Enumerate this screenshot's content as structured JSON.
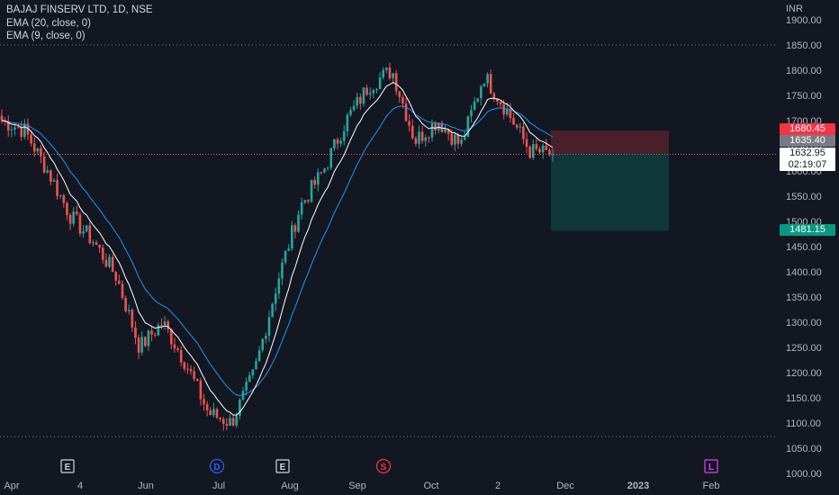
{
  "header": {
    "title": "BAJAJ FINSERV LTD, 1D, NSE",
    "indicators": [
      "EMA (20, close, 0)",
      "EMA (9, close, 0)"
    ],
    "currency": "INR"
  },
  "price_tags": {
    "stop_loss": "1680.45",
    "entry": "1635.40",
    "last": "1632.95",
    "countdown": "02:19:07",
    "target": "1481.15"
  },
  "events": [
    {
      "label": "E",
      "type": "earnings",
      "color": "#d1d4dc"
    },
    {
      "label": "D",
      "type": "dividend",
      "color": "#2962ff"
    },
    {
      "label": "E",
      "type": "earnings",
      "color": "#d1d4dc"
    },
    {
      "label": "S",
      "type": "split",
      "color": "#f23645"
    },
    {
      "label": "L",
      "type": "listing",
      "color": "#e040fb"
    }
  ],
  "colors": {
    "background": "#131722",
    "up": "#26a69a",
    "down": "#ef5350",
    "ema20": "#2196f3",
    "ema9": "#ffffff",
    "grid": "#1e222d",
    "axis_text": "#b2b5be",
    "stop_zone": "rgba(242,54,69,0.25)",
    "target_zone": "rgba(8,153,129,0.25)"
  },
  "chart_data": {
    "type": "candlestick",
    "title": "BAJAJ FINSERV LTD, 1D, NSE",
    "ylabel": "INR",
    "ylim": [
      1000,
      1900
    ],
    "y_ticks": [
      "1900.00",
      "1850.00",
      "1800.00",
      "1750.00",
      "1700.00",
      "1650.00",
      "1600.00",
      "1550.00",
      "1500.00",
      "1450.00",
      "1400.00",
      "1350.00",
      "1300.00",
      "1250.00",
      "1200.00",
      "1150.00",
      "1100.00",
      "1050.00",
      "1000.00"
    ],
    "x_ticks": [
      "Apr",
      "4",
      "Jun",
      "Jul",
      "Aug",
      "Sep",
      "Oct",
      "2",
      "Dec",
      "2023",
      "Feb"
    ],
    "grid": false,
    "dotted_levels": [
      1850,
      1073
    ],
    "key_points": [
      {
        "date": "Apr",
        "close": 1700
      },
      {
        "date": "Apr",
        "close": 1680
      },
      {
        "date": "Apr",
        "close": 1600
      },
      {
        "date": "4",
        "close": 1510
      },
      {
        "date": "4",
        "close": 1460
      },
      {
        "date": "4",
        "close": 1390
      },
      {
        "date": "Jun",
        "close": 1250
      },
      {
        "date": "Jun",
        "close": 1300
      },
      {
        "date": "Jun",
        "close": 1220
      },
      {
        "date": "Jul",
        "close": 1120
      },
      {
        "date": "Jul",
        "close": 1100
      },
      {
        "date": "Jul",
        "close": 1200
      },
      {
        "date": "Aug",
        "close": 1380
      },
      {
        "date": "Aug",
        "close": 1530
      },
      {
        "date": "Aug",
        "close": 1600
      },
      {
        "date": "Sep",
        "close": 1700
      },
      {
        "date": "Sep",
        "close": 1770
      },
      {
        "date": "Sep",
        "close": 1800
      },
      {
        "date": "Oct",
        "close": 1660
      },
      {
        "date": "Oct",
        "close": 1700
      },
      {
        "date": "2",
        "close": 1650
      },
      {
        "date": "2",
        "close": 1790
      },
      {
        "date": "2",
        "close": 1720
      },
      {
        "date": "Dec",
        "close": 1640
      },
      {
        "date": "Dec",
        "close": 1632.95
      }
    ],
    "position": {
      "type": "short",
      "entry": 1635.4,
      "stop": 1680.45,
      "target": 1481.15
    },
    "legend": [
      "EMA (20, close, 0)",
      "EMA (9, close, 0)"
    ]
  }
}
